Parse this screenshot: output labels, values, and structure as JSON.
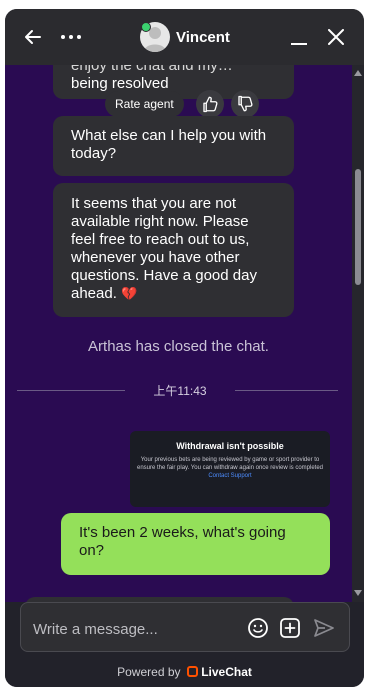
{
  "header": {
    "agent_name": "Vincent"
  },
  "messages": {
    "partial_top_line1": "enjoy the chat and my…",
    "partial_top_line2": "being resolved",
    "rate_label": "Rate agent",
    "help_text": "What else can I help you with today?",
    "away_text": "It seems that you are not available right now. Please feel free to reach out to us, whenever you have other questions. Have a good day ahead.",
    "away_emoji": "💔",
    "system_closed": "Arthas has closed the chat.",
    "timestamp": "上午11:43",
    "attachment": {
      "title": "Withdrawal isn't possible",
      "body": "Your previous bets are being reviewed by game or sport provider to ensure the fair play. You can withdraw again once review is completed",
      "link": "Contact Support"
    },
    "user_message": "It's been 2 weeks, what's going on?"
  },
  "composer": {
    "placeholder": "Write a message..."
  },
  "footer": {
    "powered_by": "Powered by",
    "brand": "LiveChat",
    "brand_color": "#ff5100"
  },
  "colors": {
    "chat_background": "#2a0b52",
    "user_bubble": "#94e05a",
    "agent_bubble": "#2f2f33"
  }
}
